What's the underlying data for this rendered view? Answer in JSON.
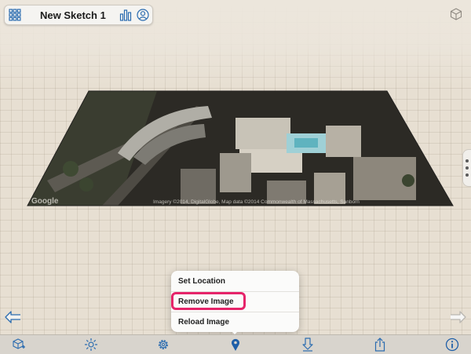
{
  "app": {
    "sketch_title": "New Sketch 1"
  },
  "map": {
    "watermark": "Google",
    "attribution": "Imagery ©2014, DigitalGlobe, Map data ©2014 Commonwealth of Massachusetts, Sanborn"
  },
  "location_menu": {
    "items": [
      {
        "label": "Set Location"
      },
      {
        "label": "Remove Image"
      },
      {
        "label": "Reload Image"
      }
    ],
    "highlighted_index": 1,
    "highlight_color": "#e6246a"
  },
  "toolbar": {
    "buttons": [
      {
        "icon": "add-box-icon"
      },
      {
        "icon": "light-icon"
      },
      {
        "icon": "gear-icon"
      },
      {
        "icon": "location-pin-icon",
        "active": true
      },
      {
        "icon": "download-icon"
      },
      {
        "icon": "share-icon"
      },
      {
        "icon": "info-icon"
      }
    ],
    "accent_color": "#1f5fa8"
  },
  "icons": {
    "grid": "grid-icon",
    "stats": "bar-chart-icon",
    "profile": "person-icon",
    "view_cube": "view-cube-icon",
    "undo": "undo-arrow-icon",
    "redo": "redo-arrow-icon"
  }
}
